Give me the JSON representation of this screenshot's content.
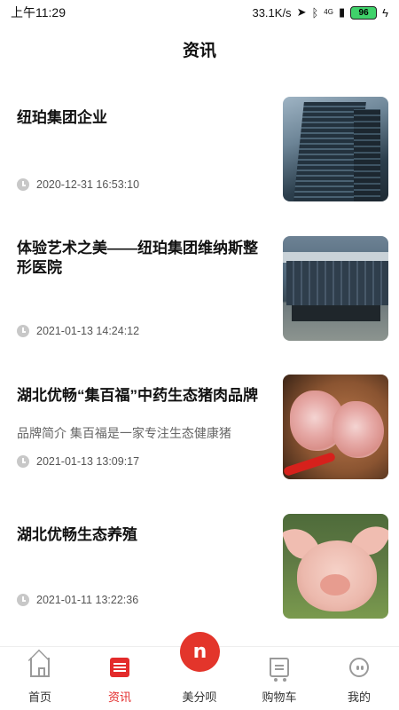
{
  "status_bar": {
    "time": "上午11:29",
    "net_speed": "33.1K/s",
    "network_tag": "4G",
    "battery": "96"
  },
  "header": {
    "title": "资讯"
  },
  "news": [
    {
      "title": "纽珀集团企业",
      "summary": "",
      "time": "2020-12-31 16:53:10",
      "image": "office-tower-photo"
    },
    {
      "title": "体验艺术之美——纽珀集团维纳斯整形医院",
      "summary": "",
      "time": "2021-01-13 14:24:12",
      "image": "clinic-building-photo"
    },
    {
      "title": "湖北优畅“集百福”中药生态猪肉品牌",
      "summary": "品牌简介 集百福是一家专注生态健康猪",
      "time": "2021-01-13 13:09:17",
      "image": "pork-steak-photo"
    },
    {
      "title": "湖北优畅生态养殖",
      "summary": "",
      "time": "2021-01-11 13:22:36",
      "image": "pig-photo"
    }
  ],
  "tabs": [
    {
      "label": "首页",
      "icon": "home-icon",
      "active": false
    },
    {
      "label": "资讯",
      "icon": "news-icon",
      "active": true
    },
    {
      "label": "美分呗",
      "icon": "mei-logo-icon",
      "active": false
    },
    {
      "label": "购物车",
      "icon": "cart-icon",
      "active": false
    },
    {
      "label": "我的",
      "icon": "profile-icon",
      "active": false
    }
  ],
  "center_logo_glyph": "n",
  "colors": {
    "accent": "#e32b2b",
    "text": "#111111",
    "muted": "#666666"
  }
}
